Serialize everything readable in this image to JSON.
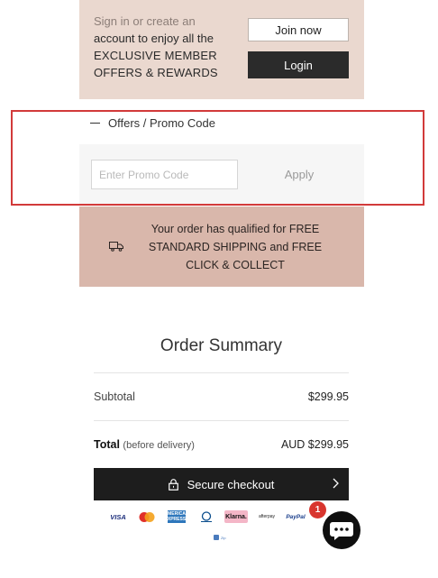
{
  "member": {
    "line1": "Sign in or create an",
    "line2": "account to enjoy all the",
    "line3": "EXCLUSIVE MEMBER",
    "line4": "OFFERS & REWARDS",
    "join_label": "Join now",
    "login_label": "Login"
  },
  "promo": {
    "toggle_label": "Offers / Promo Code",
    "placeholder": "Enter Promo Code",
    "apply_label": "Apply"
  },
  "shipping": {
    "t1": "Your order has qualified for",
    "t2": "FREE",
    "t3": "STANDARD SHIPPING",
    "t4": "and",
    "t5": "FREE",
    "t6": "CLICK & COLLECT"
  },
  "summary": {
    "title": "Order Summary",
    "subtotal_label": "Subtotal",
    "subtotal_value": "$299.95",
    "total_label": "Total",
    "total_note": "(before delivery)",
    "total_value": "AUD $299.95",
    "checkout_label": "Secure checkout"
  },
  "payments": {
    "visa": "VISA",
    "amex": "AMERICAN EXPRESS",
    "klarna": "Klarna.",
    "afterpay": "afterpay",
    "paypal": "PayPal",
    "zip": "Zip"
  },
  "chat": {
    "badge_count": "1"
  },
  "colors": {
    "member_bg": "#ead8cf",
    "shipping_bg": "#d9b7ab",
    "button_dark": "#2b2b2b",
    "highlight_frame": "#d23a3a"
  }
}
